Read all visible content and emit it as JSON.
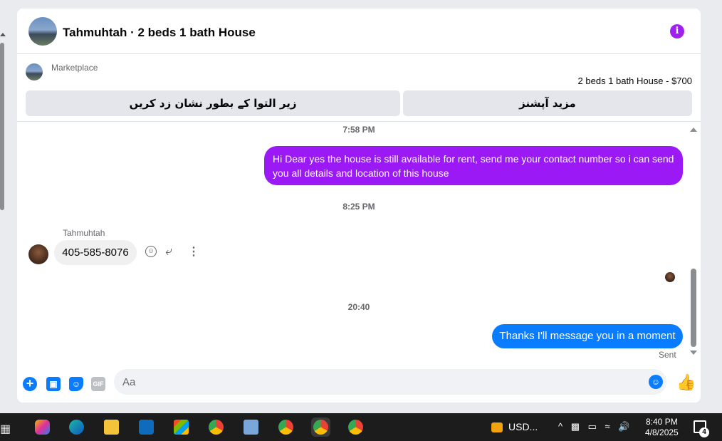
{
  "header": {
    "title": "Tahmuhtah · 2 beds 1 bath House"
  },
  "marketplace": {
    "label": "Marketplace",
    "listing": "2 beds 1 bath House - $700",
    "mark_sold_button": "زیر التوا کے بطور نشان زد کریں",
    "more_options_button": "مزید آپشنز"
  },
  "messages": {
    "ts1": "7:58 PM",
    "out1": "Hi Dear yes the house is still available for rent, send me your contact number so i can send you all details and location of this house",
    "ts2": "8:25 PM",
    "sender": "Tahmuhtah",
    "in1": "405-585-8076",
    "ts3": "20:40",
    "out2": "Thanks I'll message you in a moment",
    "status": "Sent"
  },
  "composer": {
    "placeholder": "Aa",
    "gif_label": "GIF"
  },
  "taskbar": {
    "weather": "USD...",
    "time": "8:40 PM",
    "date": "4/8/2025",
    "notif_count": "4"
  },
  "colors": {
    "purple_bubble": "#9b19f5",
    "blue_bubble": "#0a7cff",
    "info_icon": "#a020f0"
  }
}
